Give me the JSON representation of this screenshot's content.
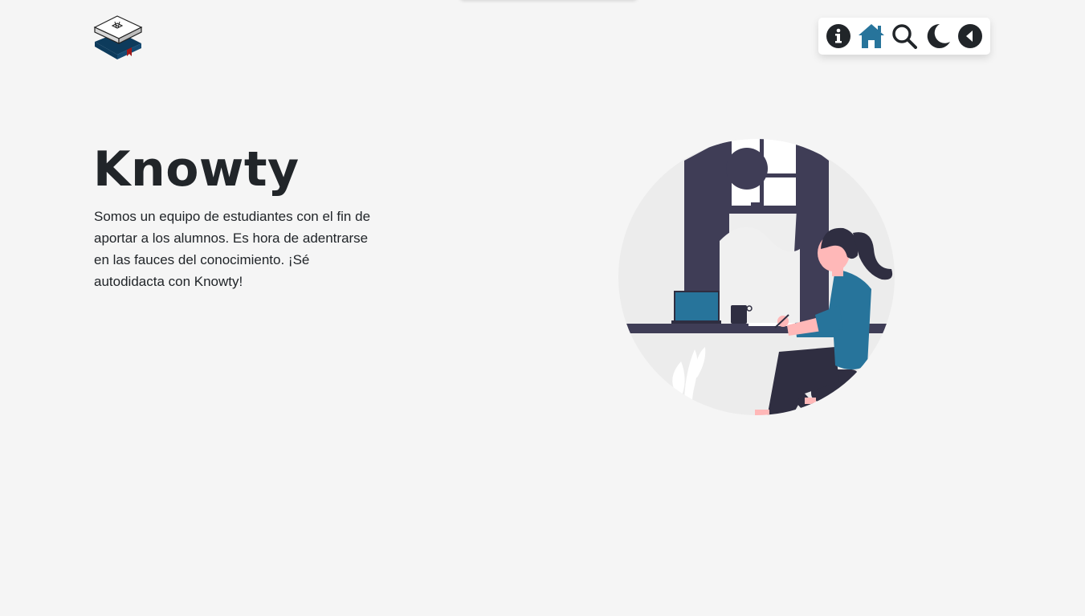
{
  "header": {
    "logo_name": "books-logo"
  },
  "nav": {
    "items": [
      {
        "icon": "info-icon",
        "color": "#212529"
      },
      {
        "icon": "home-icon",
        "color": "#27749b"
      },
      {
        "icon": "search-icon",
        "color": "#212529"
      },
      {
        "icon": "moon-icon",
        "color": "#212529"
      },
      {
        "icon": "back-arrow-icon",
        "color": "#212529"
      }
    ]
  },
  "hero": {
    "title": "Knowty",
    "description": "Somos un equipo de estudiantes con el fin de aportar a los alumnos. Es hora de adentrarse en las fauces del conocimiento. ¡Sé autodidacta con Knowty!"
  },
  "colors": {
    "background": "#f5f5f5",
    "accent": "#27749b",
    "dark": "#212529",
    "illustration_dark": "#3f3d56"
  }
}
